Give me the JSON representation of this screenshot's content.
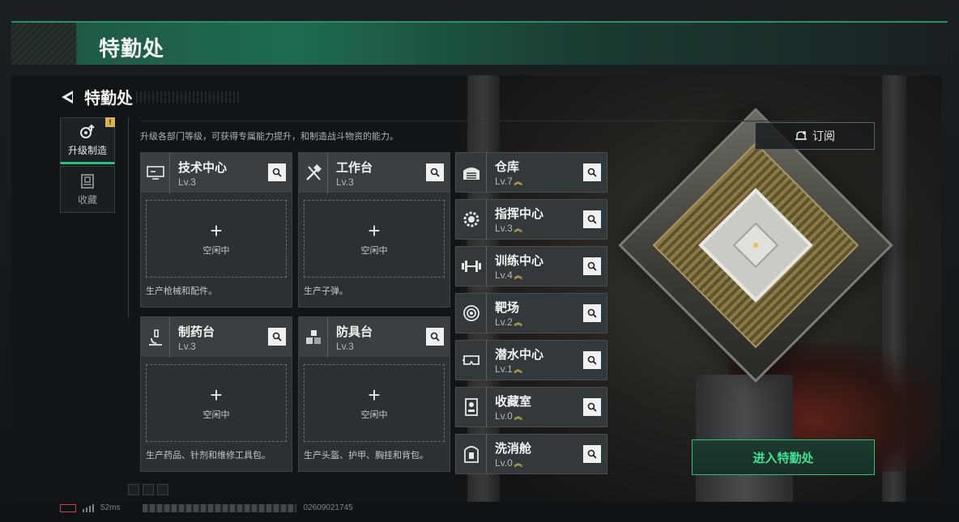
{
  "title": "特勤处",
  "header": {
    "back_title": "特勤处"
  },
  "sidebar": {
    "tabs": [
      {
        "label": "升级制造",
        "icon": "upgrade-gear-icon",
        "badge": "!"
      },
      {
        "label": "收藏",
        "icon": "collection-icon"
      }
    ]
  },
  "description": "升级各部门等级，可获得专属能力提升，和制造战斗物资的能力。",
  "subscribe_label": "订阅",
  "stations": [
    {
      "name": "技术中心",
      "level": "Lv.3",
      "icon": "computer-icon",
      "slot_plus": "+",
      "slot_status": "空闲中",
      "note": "生产枪械和配件。"
    },
    {
      "name": "工作台",
      "level": "Lv.3",
      "icon": "tools-icon",
      "slot_plus": "+",
      "slot_status": "空闲中",
      "note": "生产子弹。"
    },
    {
      "name": "制药台",
      "level": "Lv.3",
      "icon": "microscope-icon",
      "slot_plus": "+",
      "slot_status": "空闲中",
      "note": "生产药品、针剂和维修工具包。"
    },
    {
      "name": "防具台",
      "level": "Lv.3",
      "icon": "armor-icon",
      "slot_plus": "+",
      "slot_status": "空闲中",
      "note": "生产头盔、护甲、胸挂和背包。"
    }
  ],
  "facilities": [
    {
      "name": "仓库",
      "level": "Lv.7",
      "icon": "warehouse-icon"
    },
    {
      "name": "指挥中心",
      "level": "Lv.3",
      "icon": "command-gear-icon"
    },
    {
      "name": "训练中心",
      "level": "Lv.4",
      "icon": "dumbbell-icon"
    },
    {
      "name": "靶场",
      "level": "Lv.2",
      "icon": "target-icon"
    },
    {
      "name": "潜水中心",
      "level": "Lv.1",
      "icon": "diving-mask-icon"
    },
    {
      "name": "收藏室",
      "level": "Lv.0",
      "icon": "display-case-icon"
    },
    {
      "name": "洗消舱",
      "level": "Lv.0",
      "icon": "decontamination-icon"
    }
  ],
  "upgrade_glyph": "︽",
  "enter_label": "进入特勤处",
  "footer": {
    "ping": "52ms",
    "uid": "02609021745"
  },
  "colors": {
    "accent": "#2fbf7d",
    "upgrade": "#d9b64a",
    "banner": "#1f6b52"
  }
}
